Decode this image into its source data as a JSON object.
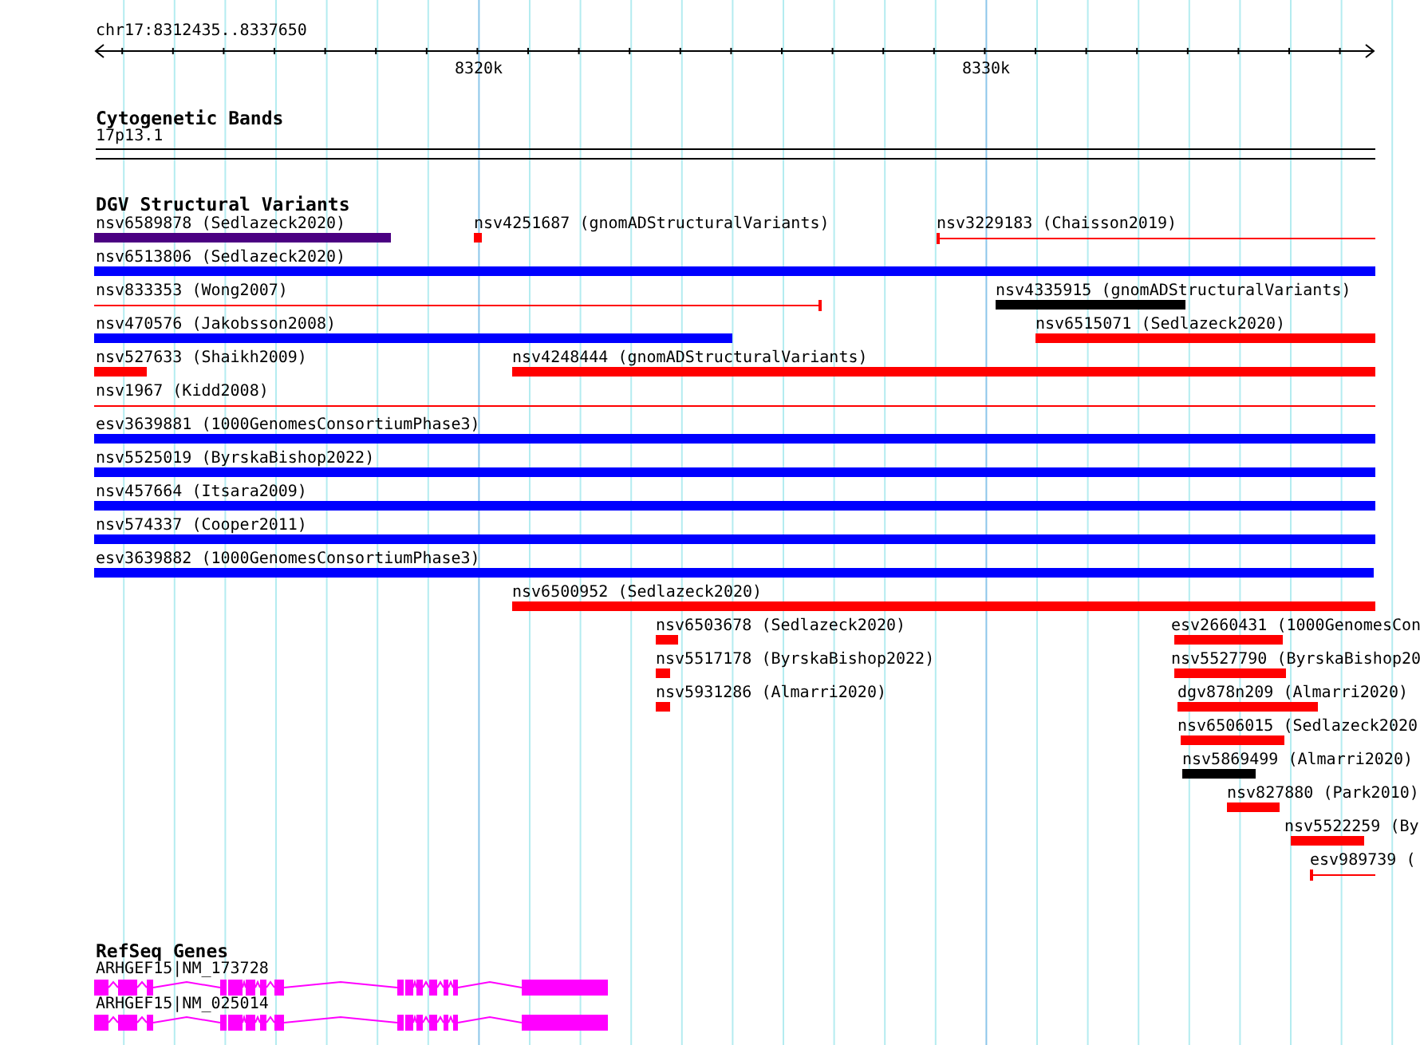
{
  "ruler": {
    "location": "chr17:8312435..8337650",
    "ticks": [
      "8320k",
      "8330k"
    ]
  },
  "cytogenetic_bands": {
    "title": "Cytogenetic Bands",
    "bands": [
      {
        "label": "17p13.1"
      }
    ]
  },
  "dgv_structural_variants": {
    "title": "DGV Structural Variants",
    "features": [
      {
        "label": "nsv6589878 (Sedlazeck2020)",
        "color": "#4b0082",
        "kind": "bar"
      },
      {
        "label": "nsv4251687 (gnomADStructuralVariants)",
        "color": "#ff0000",
        "kind": "bar"
      },
      {
        "label": "nsv3229183 (Chaisson2019)",
        "color": "#ff0000",
        "kind": "line"
      },
      {
        "label": "nsv6513806 (Sedlazeck2020)",
        "color": "#0000ff",
        "kind": "bar"
      },
      {
        "label": "nsv833353 (Wong2007)",
        "color": "#ff0000",
        "kind": "line"
      },
      {
        "label": "nsv4335915 (gnomADStructuralVariants)",
        "color": "#000000",
        "kind": "bar"
      },
      {
        "label": "nsv470576 (Jakobsson2008)",
        "color": "#0000ff",
        "kind": "bar"
      },
      {
        "label": "nsv6515071 (Sedlazeck2020)",
        "color": "#ff0000",
        "kind": "bar"
      },
      {
        "label": "nsv527633 (Shaikh2009)",
        "color": "#ff0000",
        "kind": "bar"
      },
      {
        "label": "nsv4248444 (gnomADStructuralVariants)",
        "color": "#ff0000",
        "kind": "bar"
      },
      {
        "label": "nsv1967 (Kidd2008)",
        "color": "#ff0000",
        "kind": "line"
      },
      {
        "label": "esv3639881 (1000GenomesConsortiumPhase3)",
        "color": "#0000ff",
        "kind": "bar"
      },
      {
        "label": "nsv5525019 (ByrskaBishop2022)",
        "color": "#0000ff",
        "kind": "bar"
      },
      {
        "label": "nsv457664 (Itsara2009)",
        "color": "#0000ff",
        "kind": "bar"
      },
      {
        "label": "nsv574337 (Cooper2011)",
        "color": "#0000ff",
        "kind": "bar"
      },
      {
        "label": "esv3639882 (1000GenomesConsortiumPhase3)",
        "color": "#0000ff",
        "kind": "bar"
      },
      {
        "label": "nsv6500952 (Sedlazeck2020)",
        "color": "#ff0000",
        "kind": "bar"
      },
      {
        "label": "nsv6503678 (Sedlazeck2020)",
        "color": "#ff0000",
        "kind": "bar"
      },
      {
        "label": "esv2660431 (1000GenomesCon",
        "color": "#ff0000",
        "kind": "bar"
      },
      {
        "label": "nsv5517178 (ByrskaBishop2022)",
        "color": "#ff0000",
        "kind": "bar"
      },
      {
        "label": "nsv5527790 (ByrskaBishop20",
        "color": "#ff0000",
        "kind": "bar"
      },
      {
        "label": "nsv5931286 (Almarri2020)",
        "color": "#ff0000",
        "kind": "bar"
      },
      {
        "label": "dgv878n209 (Almarri2020)",
        "color": "#ff0000",
        "kind": "bar"
      },
      {
        "label": "nsv6506015 (Sedlazeck2020",
        "color": "#ff0000",
        "kind": "bar"
      },
      {
        "label": "nsv5869499 (Almarri2020)",
        "color": "#000000",
        "kind": "bar"
      },
      {
        "label": "nsv827880 (Park2010)",
        "color": "#ff0000",
        "kind": "bar"
      },
      {
        "label": "nsv5522259 (By",
        "color": "#ff0000",
        "kind": "bar"
      },
      {
        "label": "esv989739 (",
        "color": "#ff0000",
        "kind": "line"
      }
    ]
  },
  "refseq_genes": {
    "title": "RefSeq Genes",
    "genes": [
      {
        "label": "ARHGEF15|NM_173728"
      },
      {
        "label": "ARHGEF15|NM_025014"
      }
    ]
  }
}
